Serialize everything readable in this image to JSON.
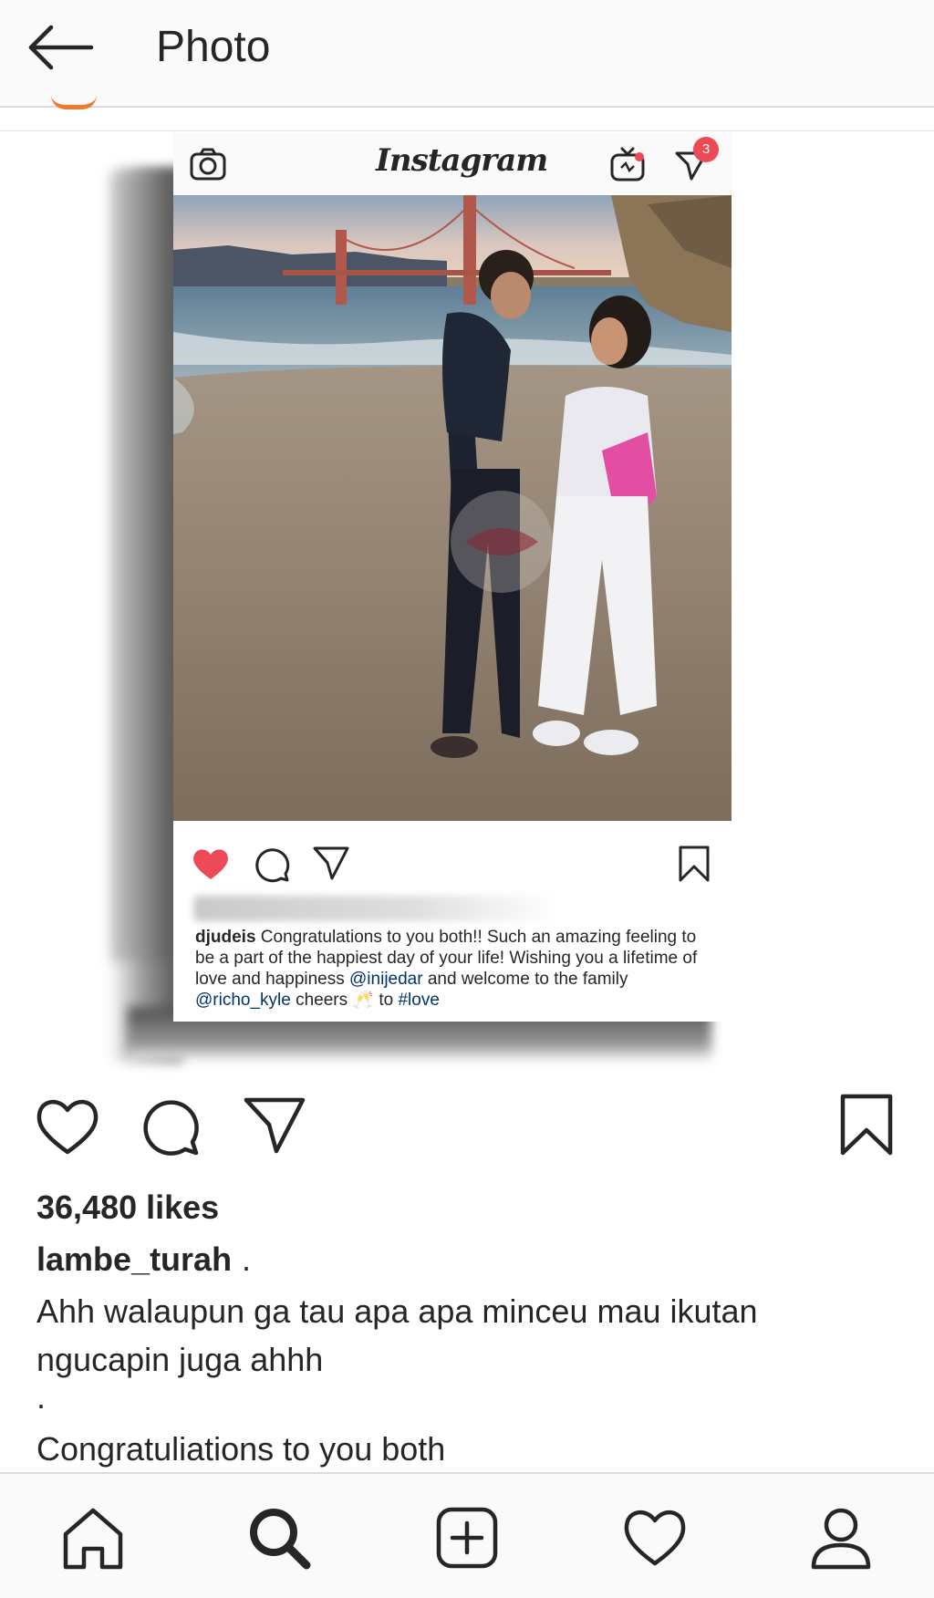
{
  "header": {
    "title": "Photo",
    "back_icon": "arrow-left-icon"
  },
  "embedded_post": {
    "logo": "Instagram",
    "dm_badge_count": "3",
    "caption": {
      "username": "djudeis",
      "text_1": " Congratulations to you both!! Such an amazing feeling to be a part of the happiest day of your life! Wishing you a lifetime of love and happiness ",
      "mention_1": "@inijedar",
      "text_2": " and welcome to the family ",
      "mention_2": "@richo_kyle",
      "text_3": " cheers 🥂 to ",
      "hashtag": "#love"
    },
    "liked": true,
    "colors": {
      "like_red": "#ed4956",
      "link_blue": "#003569"
    }
  },
  "post": {
    "likes": "36,480 likes",
    "username": "lambe_turah",
    "username_suffix": ".",
    "caption_text": "Ahh walaupun ga tau apa apa minceu mau ikutan ngucapin juga ahhh",
    "caption_dot": ".",
    "caption_line2": "Congratuliations to you both"
  },
  "bottom_nav": {
    "items": [
      "home-icon",
      "search-icon",
      "add-icon",
      "heart-icon",
      "profile-icon"
    ],
    "active": "search-icon"
  }
}
